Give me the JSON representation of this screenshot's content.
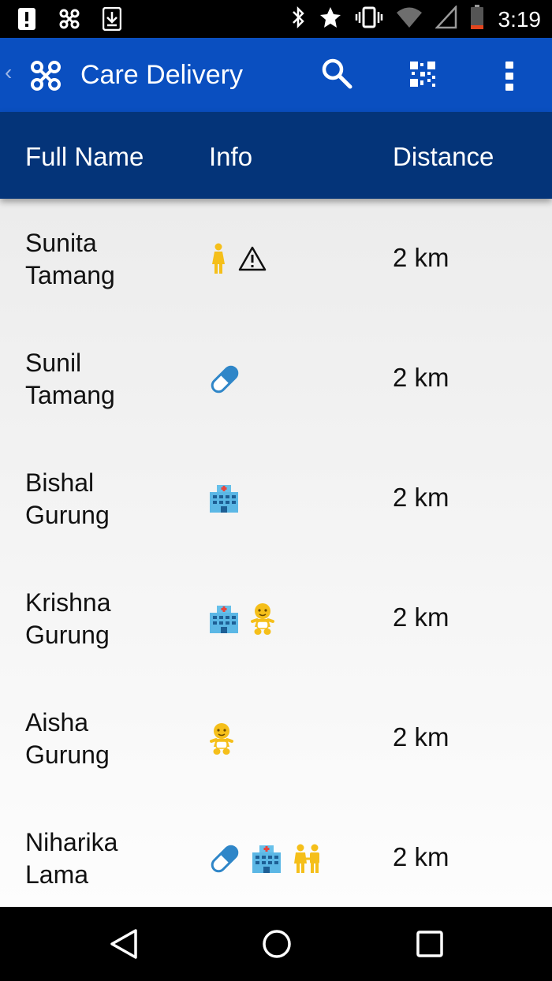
{
  "status_bar": {
    "time": "3:19",
    "icons": [
      "alert-icon",
      "app-notification-icon",
      "download-icon",
      "bluetooth-icon",
      "star-icon",
      "vibrate-icon",
      "wifi-icon",
      "signal-icon",
      "battery-icon"
    ]
  },
  "app_bar": {
    "title": "Care Delivery",
    "actions": [
      "search-icon",
      "qr-code-icon",
      "more-vert-icon"
    ]
  },
  "table": {
    "columns": [
      "Full Name",
      "Info",
      "Distance"
    ],
    "rows": [
      {
        "first": "Sunita",
        "last": "Tamang",
        "icons": [
          "pregnant-woman-icon",
          "warning-icon"
        ],
        "distance": "2 km"
      },
      {
        "first": "Sunil",
        "last": "Tamang",
        "icons": [
          "pill-icon"
        ],
        "distance": "2 km"
      },
      {
        "first": "Bishal",
        "last": "Gurung",
        "icons": [
          "hospital-icon"
        ],
        "distance": "2 km"
      },
      {
        "first": "Krishna",
        "last": "Gurung",
        "icons": [
          "hospital-icon",
          "baby-icon"
        ],
        "distance": "2 km"
      },
      {
        "first": "Aisha",
        "last": "Gurung",
        "icons": [
          "baby-icon"
        ],
        "distance": "2 km"
      },
      {
        "first": "Niharika",
        "last": "Lama",
        "icons": [
          "pill-icon",
          "hospital-icon",
          "family-icon"
        ],
        "distance": "2 km"
      }
    ]
  },
  "colors": {
    "app_bar": "#0a4fc0",
    "header": "#043479",
    "icon_yellow": "#f5bf1a",
    "icon_blue": "#2f86c8"
  },
  "nav_bar": [
    "back-icon",
    "home-icon",
    "recents-icon"
  ]
}
